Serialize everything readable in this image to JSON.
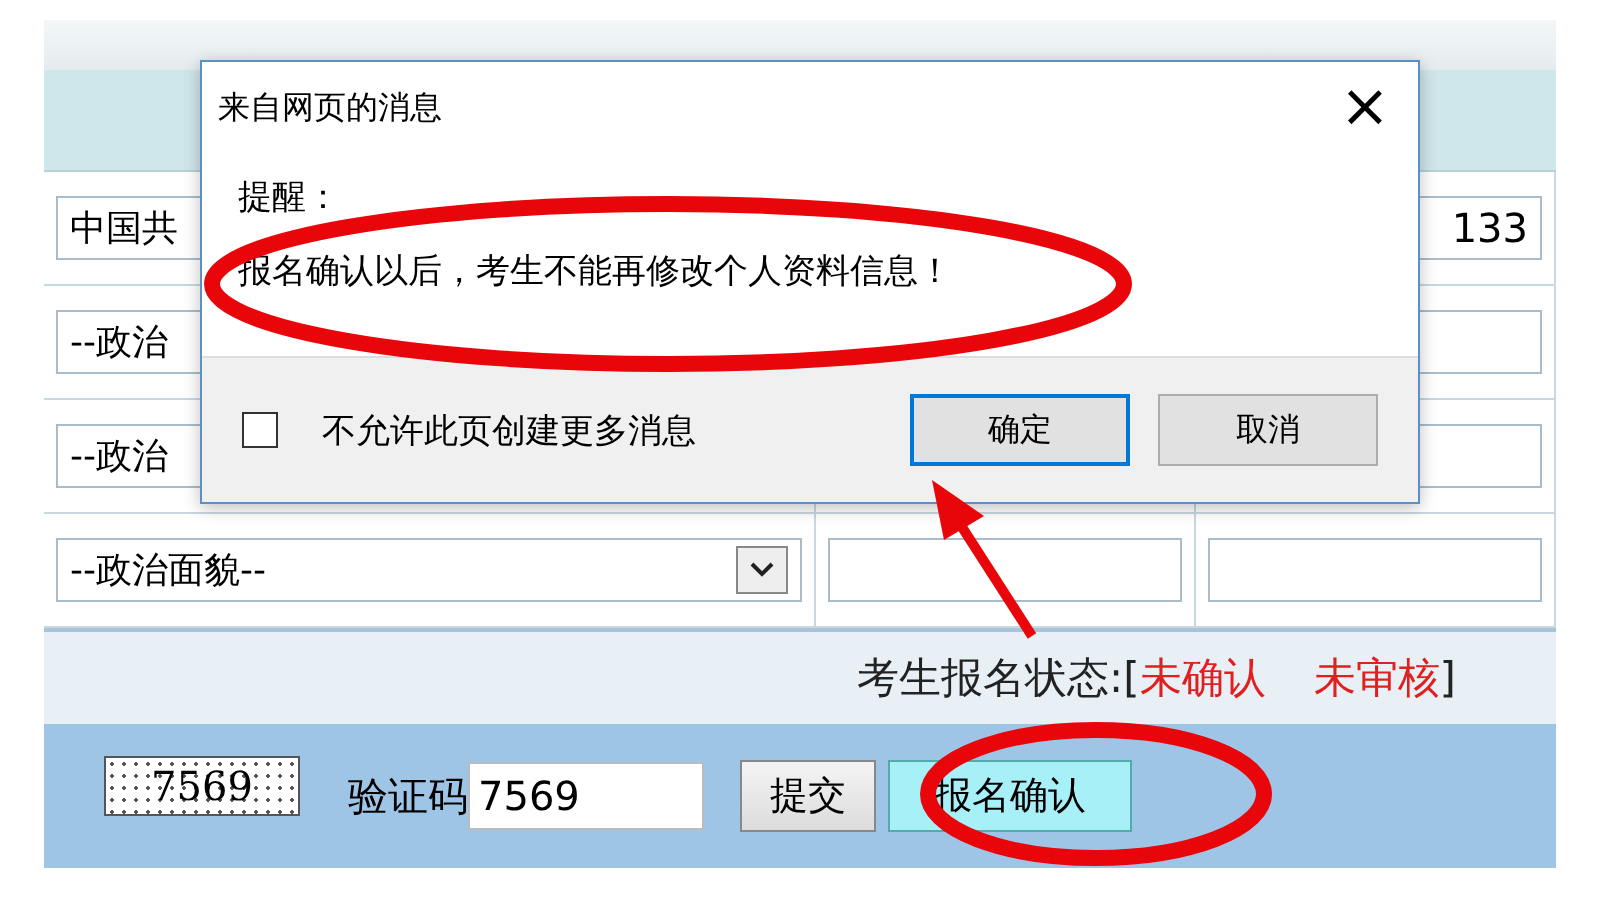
{
  "form_rows": [
    {
      "kind": "input",
      "cells": [
        "中国共",
        "",
        "133"
      ]
    },
    {
      "kind": "input",
      "cells": [
        "--政治",
        "",
        ""
      ]
    },
    {
      "kind": "input",
      "cells": [
        "--政治",
        "",
        ""
      ]
    },
    {
      "kind": "select",
      "cells": [
        "--政治面貌--",
        "",
        ""
      ]
    }
  ],
  "status": {
    "label": "考生报名状态:[",
    "values": [
      {
        "text": "未确认",
        "color": "#e02020"
      },
      {
        "text": "未审核",
        "color": "#e02020"
      }
    ],
    "close": "]"
  },
  "captcha": {
    "image_text": "7569",
    "label": "验证码",
    "value": "7569"
  },
  "buttons": [
    {
      "label": "提交",
      "kind": "plain"
    },
    {
      "label": "报名确认",
      "kind": "highlight"
    }
  ],
  "dialog": {
    "title": "来自网页的消息",
    "close": "×",
    "heading": "提醒：",
    "message": "报名确认以后，考生不能再修改个人资料信息！",
    "checkbox": {
      "label": "不允许此页创建更多消息",
      "checked": false
    },
    "buttons": [
      {
        "label": "确定",
        "default": true
      },
      {
        "label": "取消",
        "default": false
      }
    ]
  }
}
